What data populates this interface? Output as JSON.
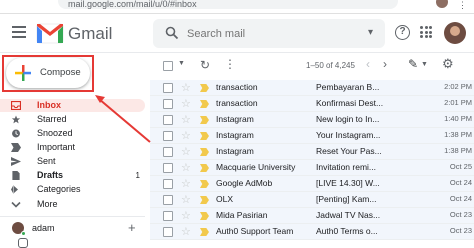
{
  "browser": {
    "url": "mail.google.com/mail/u/0/#inbox"
  },
  "header": {
    "brand": "Gmail",
    "search_placeholder": "Search mail"
  },
  "compose": {
    "label": "Compose"
  },
  "sidebar": {
    "items": [
      {
        "label": "Inbox",
        "count": "",
        "icon": "inbox-icon"
      },
      {
        "label": "Starred",
        "count": "",
        "icon": "star-icon"
      },
      {
        "label": "Snoozed",
        "count": "",
        "icon": "clock-icon"
      },
      {
        "label": "Important",
        "count": "",
        "icon": "important-icon"
      },
      {
        "label": "Sent",
        "count": "",
        "icon": "send-icon"
      },
      {
        "label": "Drafts",
        "count": "1",
        "icon": "draft-icon"
      },
      {
        "label": "Categories",
        "count": "",
        "icon": "label-icon"
      },
      {
        "label": "More",
        "count": "",
        "icon": "chevron-down-icon"
      }
    ],
    "user": {
      "name": "adam"
    }
  },
  "toolbar": {
    "range": "1–50 of 4,245"
  },
  "emails": [
    {
      "sender": "transaction",
      "subject": "Pembayaran B...",
      "date": "2:02 PM"
    },
    {
      "sender": "transaction",
      "subject": "Konfirmasi Dest...",
      "date": "2:01 PM"
    },
    {
      "sender": "Instagram",
      "subject": "New login to In...",
      "date": "1:40 PM"
    },
    {
      "sender": "Instagram",
      "subject": "Your Instagram...",
      "date": "1:38 PM"
    },
    {
      "sender": "Instagram",
      "subject": "Reset Your Pas...",
      "date": "1:38 PM"
    },
    {
      "sender": "Macquarie University",
      "subject": "Invitation remi...",
      "date": "Oct 25"
    },
    {
      "sender": "Google AdMob",
      "subject": "[LIVE 14.30] W...",
      "date": "Oct 24"
    },
    {
      "sender": "OLX",
      "subject": "[Penting] Kam...",
      "date": "Oct 24"
    },
    {
      "sender": "Mida Pasirian",
      "subject": "Jadwal TV Nas...",
      "date": "Oct 23"
    },
    {
      "sender": "Auth0 Support Team",
      "subject": "Auth0 Terms o...",
      "date": "Oct 23"
    }
  ],
  "colors": {
    "accent_red": "#d93025",
    "annotation_red": "#e53935",
    "important_yellow": "#f2c94c"
  }
}
